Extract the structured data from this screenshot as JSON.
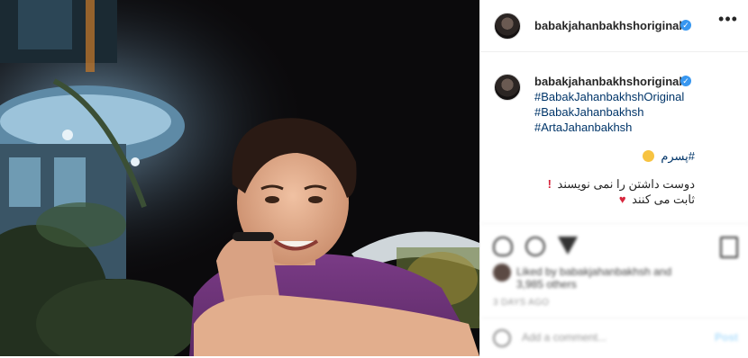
{
  "post": {
    "username": "babakjahanbakhshoriginal",
    "verified": true
  },
  "header": {
    "avatar_icon": "profile-avatar",
    "verified_icon": "verified-badge-icon",
    "more_label": "•••"
  },
  "caption": {
    "hashtags": [
      "#BabakJahanbakhshOriginal",
      "#BabakJahanbakhsh",
      "#ArtaJahanbakhsh"
    ],
    "line1_tag": "#پسرم",
    "line1_emoji": "smiling-face-with-hearts-icon",
    "line2": "دوست داشتن را نمی نویسند",
    "line3": "ثابت می کنند",
    "line2_emoji": "red-exclamation-icon",
    "line3_emoji": "red-heart-icon"
  },
  "actions": {
    "icons": [
      "heart-icon",
      "comment-icon",
      "share-icon",
      "bookmark-icon"
    ],
    "likes_text": "Liked by babakjahanbakhsh and",
    "likes_text2": "3,985 others",
    "date": "3 DAYS AGO",
    "comment_placeholder": "Add a comment...",
    "post_label": "Post"
  },
  "colors": {
    "hashtag": "#003569",
    "verified": "#3897f0",
    "border": "#efefef"
  }
}
